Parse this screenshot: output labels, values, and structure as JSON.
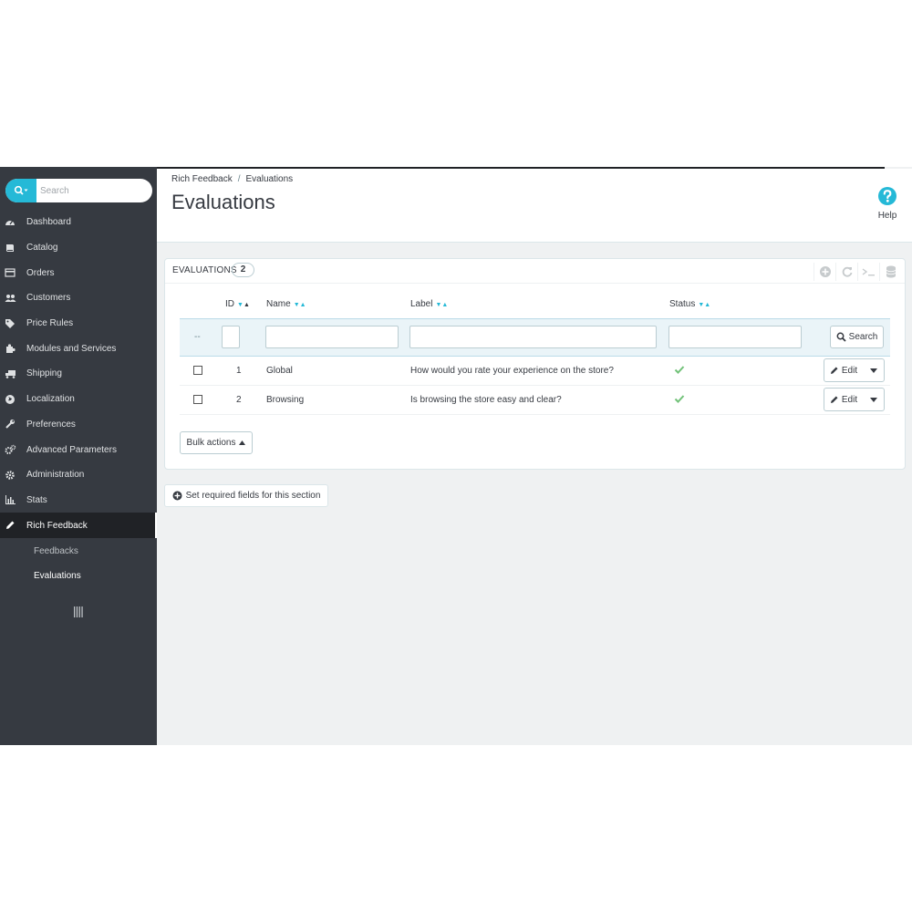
{
  "sidebar": {
    "search": {
      "placeholder": "Search"
    },
    "items": [
      {
        "label": "Dashboard",
        "icon": "dashboard-icon"
      },
      {
        "label": "Catalog",
        "icon": "book-icon"
      },
      {
        "label": "Orders",
        "icon": "credit-card-icon"
      },
      {
        "label": "Customers",
        "icon": "users-icon"
      },
      {
        "label": "Price Rules",
        "icon": "tags-icon"
      },
      {
        "label": "Modules and Services",
        "icon": "puzzle-icon"
      },
      {
        "label": "Shipping",
        "icon": "truck-icon"
      },
      {
        "label": "Localization",
        "icon": "globe-icon"
      },
      {
        "label": "Preferences",
        "icon": "wrench-icon"
      },
      {
        "label": "Advanced Parameters",
        "icon": "cogs-icon"
      },
      {
        "label": "Administration",
        "icon": "gear-icon"
      },
      {
        "label": "Stats",
        "icon": "bar-chart-icon"
      },
      {
        "label": "Rich Feedback",
        "icon": "pencil-icon",
        "active": true
      }
    ],
    "subitems": [
      {
        "label": "Feedbacks"
      },
      {
        "label": "Evaluations",
        "active": true
      }
    ]
  },
  "header": {
    "breadcrumb": [
      "Rich Feedback",
      "Evaluations"
    ],
    "breadcrumb_sep": "/",
    "title": "Evaluations",
    "help_label": "Help"
  },
  "panel": {
    "title": "EVALUATIONS",
    "count": "2",
    "columns": {
      "id": "ID",
      "name": "Name",
      "label": "Label",
      "status": "Status"
    },
    "filter_dash": "--",
    "search_button": "Search",
    "rows": [
      {
        "id": "1",
        "name": "Global",
        "label": "How would you rate your experience on the store?",
        "status": "enabled"
      },
      {
        "id": "2",
        "name": "Browsing",
        "label": "Is browsing the store easy and clear?",
        "status": "enabled"
      }
    ],
    "edit_label": "Edit",
    "bulk_actions": "Bulk actions"
  },
  "required_fields_button": "Set required fields for this section",
  "colors": {
    "accent": "#25b9d7",
    "sidebar": "#363a41",
    "success": "#72c279"
  }
}
